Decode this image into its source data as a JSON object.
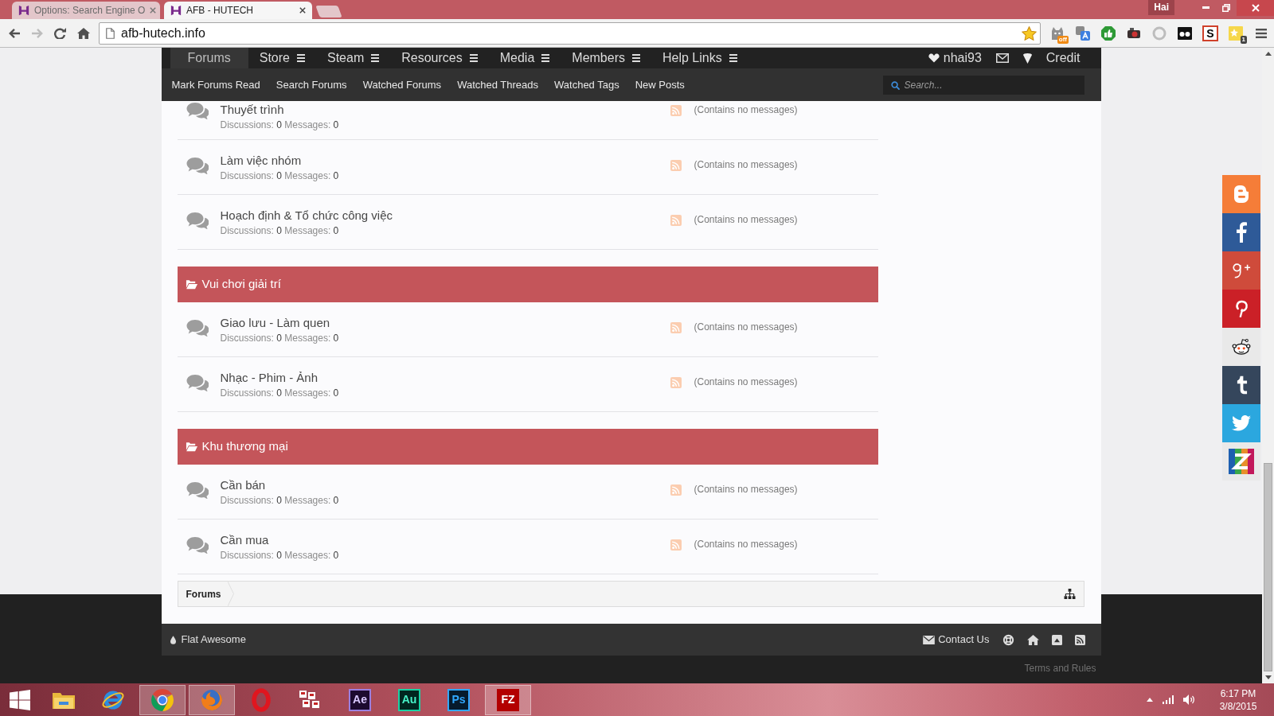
{
  "browser": {
    "tabs": [
      {
        "title": "Options: Search Engine O",
        "selected": false
      },
      {
        "title": "AFB - HUTECH",
        "selected": true
      }
    ],
    "profile": "Hai",
    "nav_buttons": [
      {
        "kind": "back",
        "disabled": false
      },
      {
        "kind": "forward",
        "disabled": true
      },
      {
        "kind": "reload",
        "disabled": false
      },
      {
        "kind": "home",
        "disabled": false
      }
    ],
    "address": "afb-hutech.info",
    "bookmarked": true,
    "extensions": [
      {
        "kind": "cat",
        "badge": "off"
      },
      {
        "kind": "translate"
      },
      {
        "kind": "thumb"
      },
      {
        "kind": "camera"
      },
      {
        "kind": "ring"
      },
      {
        "kind": "glasses"
      },
      {
        "kind": "letter",
        "label": "S"
      },
      {
        "kind": "note",
        "badge": "1"
      }
    ]
  },
  "nav": {
    "tabs": [
      {
        "label": "Forums",
        "selected": true,
        "has_menu": false
      },
      {
        "label": "Store",
        "selected": false,
        "has_menu": true
      },
      {
        "label": "Steam",
        "selected": false,
        "has_menu": true
      },
      {
        "label": "Resources",
        "selected": false,
        "has_menu": true
      },
      {
        "label": "Media",
        "selected": false,
        "has_menu": true
      },
      {
        "label": "Members",
        "selected": false,
        "has_menu": true
      },
      {
        "label": "Help Links",
        "selected": false,
        "has_menu": true
      }
    ],
    "user": "nhai93",
    "credit": "Credit"
  },
  "subnav": {
    "links": [
      "Mark Forums Read",
      "Search Forums",
      "Watched Forums",
      "Watched Threads",
      "Watched Tags",
      "New Posts"
    ],
    "search": {
      "placeholder": "Search..."
    }
  },
  "categories": [
    {
      "forums": [
        {
          "title": "Thuyết trình",
          "stats": [
            {
              "label": "Discussions:",
              "value": "0"
            },
            {
              "label": "Messages:",
              "value": "0"
            }
          ],
          "last_post": "(Contains no messages)"
        },
        {
          "title": "Làm việc nhóm",
          "stats": [
            {
              "label": "Discussions:",
              "value": "0"
            },
            {
              "label": "Messages:",
              "value": "0"
            }
          ],
          "last_post": "(Contains no messages)"
        },
        {
          "title": "Hoạch định & Tổ chức công việc",
          "stats": [
            {
              "label": "Discussions:",
              "value": "0"
            },
            {
              "label": "Messages:",
              "value": "0"
            }
          ],
          "last_post": "(Contains no messages)"
        }
      ]
    },
    {
      "title": "Vui chơi giải trí",
      "forums": [
        {
          "title": "Giao lưu - Làm quen",
          "stats": [
            {
              "label": "Discussions:",
              "value": "0"
            },
            {
              "label": "Messages:",
              "value": "0"
            }
          ],
          "last_post": "(Contains no messages)"
        },
        {
          "title": "Nhạc - Phim - Ảnh",
          "stats": [
            {
              "label": "Discussions:",
              "value": "0"
            },
            {
              "label": "Messages:",
              "value": "0"
            }
          ],
          "last_post": "(Contains no messages)"
        }
      ]
    },
    {
      "title": "Khu thương mại",
      "forums": [
        {
          "title": "Cần bán",
          "stats": [
            {
              "label": "Discussions:",
              "value": "0"
            },
            {
              "label": "Messages:",
              "value": "0"
            }
          ],
          "last_post": "(Contains no messages)"
        },
        {
          "title": "Cần mua",
          "stats": [
            {
              "label": "Discussions:",
              "value": "0"
            },
            {
              "label": "Messages:",
              "value": "0"
            }
          ],
          "last_post": "(Contains no messages)"
        }
      ]
    }
  ],
  "breadcrumb": [
    "Forums"
  ],
  "footer": {
    "style": "Flat Awesome",
    "links": [
      {
        "kind": "contact",
        "label": "Contact Us"
      },
      {
        "kind": "help"
      },
      {
        "kind": "home"
      },
      {
        "kind": "top"
      },
      {
        "kind": "rss"
      }
    ],
    "terms": "Terms and Rules"
  },
  "share": [
    {
      "kind": "blogger"
    },
    {
      "kind": "facebook"
    },
    {
      "kind": "google-plus"
    },
    {
      "kind": "pinterest"
    },
    {
      "kind": "reddit"
    },
    {
      "kind": "tumblr"
    },
    {
      "kind": "twitter"
    },
    {
      "kind": "z"
    }
  ],
  "taskbar": {
    "apps": [
      {
        "kind": "explorer",
        "running": false
      },
      {
        "kind": "ie",
        "running": false
      },
      {
        "kind": "chrome",
        "running": true
      },
      {
        "kind": "firefox",
        "running": true
      },
      {
        "kind": "opera",
        "running": false
      },
      {
        "kind": "tiles",
        "running": false
      },
      {
        "kind": "ae",
        "label": "Ae",
        "running": false
      },
      {
        "kind": "au",
        "label": "Au",
        "running": false
      },
      {
        "kind": "ps",
        "label": "Ps",
        "running": false
      },
      {
        "kind": "fz",
        "label": "FZ",
        "running": true
      }
    ],
    "time": "6:17 PM",
    "date": "3/8/2015"
  }
}
